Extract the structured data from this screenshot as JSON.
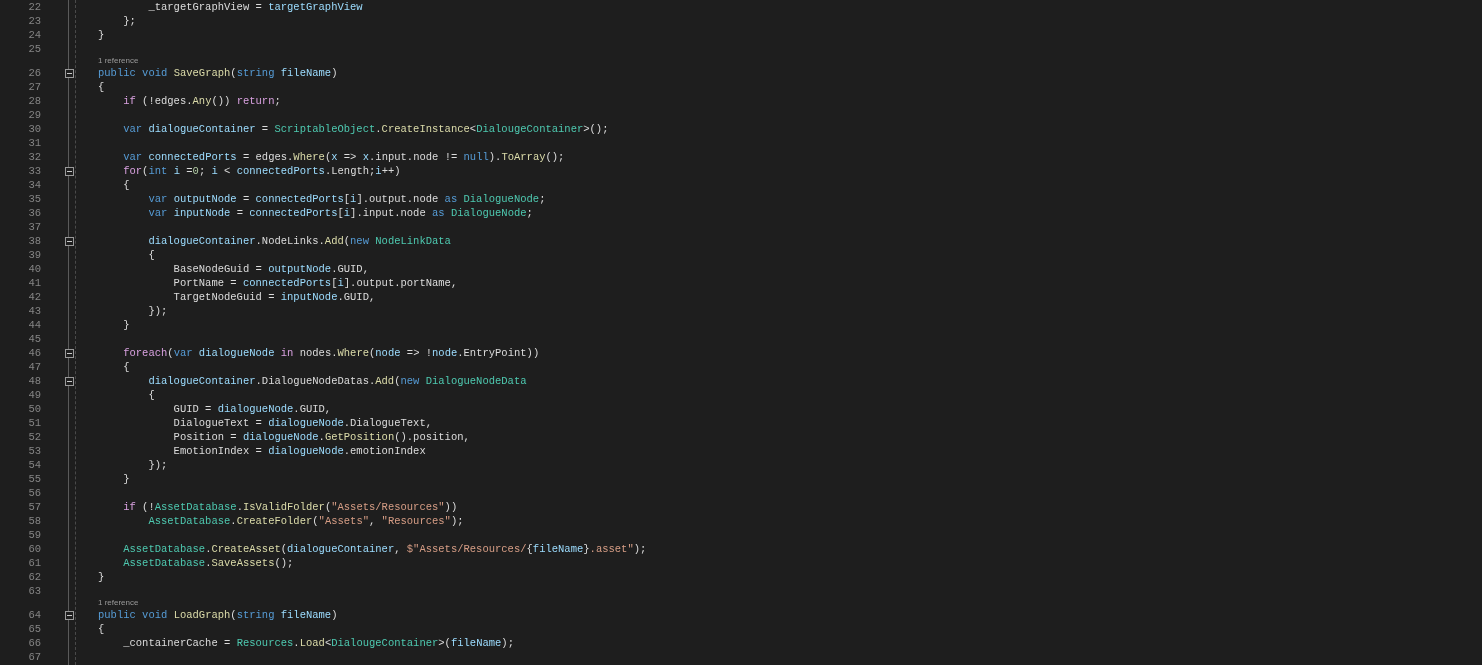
{
  "editor": {
    "lines": [
      {
        "kind": "code",
        "number": "22",
        "tokens": [
          {
            "kind": "plain",
            "text": "        _targetGraphView = "
          },
          {
            "kind": "var",
            "text": "targetGraphView"
          }
        ]
      },
      {
        "kind": "code",
        "number": "23",
        "tokens": [
          {
            "kind": "plain",
            "text": "    };"
          }
        ]
      },
      {
        "kind": "code",
        "number": "24",
        "tokens": [
          {
            "kind": "plain",
            "text": "}"
          }
        ]
      },
      {
        "kind": "code",
        "number": "25"
      },
      {
        "kind": "lens",
        "text": "1 reference"
      },
      {
        "kind": "code",
        "number": "26",
        "fold": {
          "expanded": true
        },
        "tokens": [
          {
            "kind": "kw",
            "text": "public void "
          },
          {
            "kind": "method",
            "text": "SaveGraph"
          },
          {
            "kind": "plain",
            "text": "("
          },
          {
            "kind": "kw",
            "text": "string "
          },
          {
            "kind": "var",
            "text": "fileName"
          },
          {
            "kind": "plain",
            "text": ")"
          }
        ]
      },
      {
        "kind": "code",
        "number": "27",
        "tokens": [
          {
            "kind": "plain",
            "text": "{"
          }
        ]
      },
      {
        "kind": "code",
        "number": "28",
        "tokens": [
          {
            "kind": "ctrl",
            "text": "    if"
          },
          {
            "kind": "plain",
            "text": " (!edges."
          },
          {
            "kind": "method",
            "text": "Any"
          },
          {
            "kind": "plain",
            "text": "()) "
          },
          {
            "kind": "ctrl",
            "text": "return"
          },
          {
            "kind": "plain",
            "text": ";"
          }
        ]
      },
      {
        "kind": "code",
        "number": "29"
      },
      {
        "kind": "code",
        "number": "30",
        "tokens": [
          {
            "kind": "kw",
            "text": "    var "
          },
          {
            "kind": "var",
            "text": "dialogueContainer"
          },
          {
            "kind": "plain",
            "text": " = "
          },
          {
            "kind": "type",
            "text": "ScriptableObject"
          },
          {
            "kind": "plain",
            "text": "."
          },
          {
            "kind": "method",
            "text": "CreateInstance"
          },
          {
            "kind": "plain",
            "text": "<"
          },
          {
            "kind": "type",
            "text": "DialougeContainer"
          },
          {
            "kind": "plain",
            "text": ">();"
          }
        ]
      },
      {
        "kind": "code",
        "number": "31"
      },
      {
        "kind": "code",
        "number": "32",
        "tokens": [
          {
            "kind": "kw",
            "text": "    var "
          },
          {
            "kind": "var",
            "text": "connectedPorts"
          },
          {
            "kind": "plain",
            "text": " = edges."
          },
          {
            "kind": "method",
            "text": "Where"
          },
          {
            "kind": "plain",
            "text": "("
          },
          {
            "kind": "var",
            "text": "x"
          },
          {
            "kind": "plain",
            "text": " => "
          },
          {
            "kind": "var",
            "text": "x"
          },
          {
            "kind": "plain",
            "text": ".input.node != "
          },
          {
            "kind": "kw",
            "text": "null"
          },
          {
            "kind": "plain",
            "text": ")."
          },
          {
            "kind": "method",
            "text": "ToArray"
          },
          {
            "kind": "plain",
            "text": "();"
          }
        ]
      },
      {
        "kind": "code",
        "number": "33",
        "fold": {
          "expanded": true
        },
        "tokens": [
          {
            "kind": "ctrl",
            "text": "    for"
          },
          {
            "kind": "plain",
            "text": "("
          },
          {
            "kind": "kw",
            "text": "int "
          },
          {
            "kind": "var",
            "text": "i"
          },
          {
            "kind": "plain",
            "text": " ="
          },
          {
            "kind": "num",
            "text": "0"
          },
          {
            "kind": "plain",
            "text": "; "
          },
          {
            "kind": "var",
            "text": "i"
          },
          {
            "kind": "plain",
            "text": " < "
          },
          {
            "kind": "var",
            "text": "connectedPorts"
          },
          {
            "kind": "plain",
            "text": ".Length;"
          },
          {
            "kind": "var",
            "text": "i"
          },
          {
            "kind": "plain",
            "text": "++)"
          }
        ]
      },
      {
        "kind": "code",
        "number": "34",
        "tokens": [
          {
            "kind": "plain",
            "text": "    {"
          }
        ]
      },
      {
        "kind": "code",
        "number": "35",
        "tokens": [
          {
            "kind": "kw",
            "text": "        var "
          },
          {
            "kind": "var",
            "text": "outputNode"
          },
          {
            "kind": "plain",
            "text": " = "
          },
          {
            "kind": "var",
            "text": "connectedPorts"
          },
          {
            "kind": "plain",
            "text": "["
          },
          {
            "kind": "var",
            "text": "i"
          },
          {
            "kind": "plain",
            "text": "].output.node "
          },
          {
            "kind": "kw",
            "text": "as "
          },
          {
            "kind": "type",
            "text": "DialogueNode"
          },
          {
            "kind": "plain",
            "text": ";"
          }
        ]
      },
      {
        "kind": "code",
        "number": "36",
        "tokens": [
          {
            "kind": "kw",
            "text": "        var "
          },
          {
            "kind": "var",
            "text": "inputNode"
          },
          {
            "kind": "plain",
            "text": " = "
          },
          {
            "kind": "var",
            "text": "connectedPorts"
          },
          {
            "kind": "plain",
            "text": "["
          },
          {
            "kind": "var",
            "text": "i"
          },
          {
            "kind": "plain",
            "text": "].input.node "
          },
          {
            "kind": "kw",
            "text": "as "
          },
          {
            "kind": "type",
            "text": "DialogueNode"
          },
          {
            "kind": "plain",
            "text": ";"
          }
        ]
      },
      {
        "kind": "code",
        "number": "37"
      },
      {
        "kind": "code",
        "number": "38",
        "fold": {
          "expanded": true
        },
        "tokens": [
          {
            "kind": "var",
            "text": "        dialogueContainer"
          },
          {
            "kind": "plain",
            "text": ".NodeLinks."
          },
          {
            "kind": "method",
            "text": "Add"
          },
          {
            "kind": "plain",
            "text": "("
          },
          {
            "kind": "kw",
            "text": "new "
          },
          {
            "kind": "type",
            "text": "NodeLinkData"
          }
        ]
      },
      {
        "kind": "code",
        "number": "39",
        "tokens": [
          {
            "kind": "plain",
            "text": "        {"
          }
        ]
      },
      {
        "kind": "code",
        "number": "40",
        "tokens": [
          {
            "kind": "plain",
            "text": "            BaseNodeGuid = "
          },
          {
            "kind": "var",
            "text": "outputNode"
          },
          {
            "kind": "plain",
            "text": ".GUID,"
          }
        ]
      },
      {
        "kind": "code",
        "number": "41",
        "tokens": [
          {
            "kind": "plain",
            "text": "            PortName = "
          },
          {
            "kind": "var",
            "text": "connectedPorts"
          },
          {
            "kind": "plain",
            "text": "["
          },
          {
            "kind": "var",
            "text": "i"
          },
          {
            "kind": "plain",
            "text": "].output.portName,"
          }
        ]
      },
      {
        "kind": "code",
        "number": "42",
        "tokens": [
          {
            "kind": "plain",
            "text": "            TargetNodeGuid = "
          },
          {
            "kind": "var",
            "text": "inputNode"
          },
          {
            "kind": "plain",
            "text": ".GUID,"
          }
        ]
      },
      {
        "kind": "code",
        "number": "43",
        "tokens": [
          {
            "kind": "plain",
            "text": "        });"
          }
        ]
      },
      {
        "kind": "code",
        "number": "44",
        "tokens": [
          {
            "kind": "plain",
            "text": "    }"
          }
        ]
      },
      {
        "kind": "code",
        "number": "45"
      },
      {
        "kind": "code",
        "number": "46",
        "fold": {
          "expanded": true
        },
        "tokens": [
          {
            "kind": "ctrl",
            "text": "    foreach"
          },
          {
            "kind": "plain",
            "text": "("
          },
          {
            "kind": "kw",
            "text": "var "
          },
          {
            "kind": "var",
            "text": "dialogueNode"
          },
          {
            "kind": "ctrl",
            "text": " in"
          },
          {
            "kind": "plain",
            "text": " nodes."
          },
          {
            "kind": "method",
            "text": "Where"
          },
          {
            "kind": "plain",
            "text": "("
          },
          {
            "kind": "var",
            "text": "node"
          },
          {
            "kind": "plain",
            "text": " => !"
          },
          {
            "kind": "var",
            "text": "node"
          },
          {
            "kind": "plain",
            "text": ".EntryPoint))"
          }
        ]
      },
      {
        "kind": "code",
        "number": "47",
        "tokens": [
          {
            "kind": "plain",
            "text": "    {"
          }
        ]
      },
      {
        "kind": "code",
        "number": "48",
        "fold": {
          "expanded": true
        },
        "tokens": [
          {
            "kind": "var",
            "text": "        dialogueContainer"
          },
          {
            "kind": "plain",
            "text": ".DialogueNodeDatas."
          },
          {
            "kind": "method",
            "text": "Add"
          },
          {
            "kind": "plain",
            "text": "("
          },
          {
            "kind": "kw",
            "text": "new "
          },
          {
            "kind": "type",
            "text": "DialogueNodeData"
          }
        ]
      },
      {
        "kind": "code",
        "number": "49",
        "tokens": [
          {
            "kind": "plain",
            "text": "        {"
          }
        ]
      },
      {
        "kind": "code",
        "number": "50",
        "tokens": [
          {
            "kind": "plain",
            "text": "            GUID = "
          },
          {
            "kind": "var",
            "text": "dialogueNode"
          },
          {
            "kind": "plain",
            "text": ".GUID,"
          }
        ]
      },
      {
        "kind": "code",
        "number": "51",
        "tokens": [
          {
            "kind": "plain",
            "text": "            DialogueText = "
          },
          {
            "kind": "var",
            "text": "dialogueNode"
          },
          {
            "kind": "plain",
            "text": ".DialogueText,"
          }
        ]
      },
      {
        "kind": "code",
        "number": "52",
        "tokens": [
          {
            "kind": "plain",
            "text": "            Position = "
          },
          {
            "kind": "var",
            "text": "dialogueNode"
          },
          {
            "kind": "plain",
            "text": "."
          },
          {
            "kind": "method",
            "text": "GetPosition"
          },
          {
            "kind": "plain",
            "text": "().position,"
          }
        ]
      },
      {
        "kind": "code",
        "number": "53",
        "tokens": [
          {
            "kind": "plain",
            "text": "            EmotionIndex = "
          },
          {
            "kind": "var",
            "text": "dialogueNode"
          },
          {
            "kind": "plain",
            "text": ".emotionIndex"
          }
        ]
      },
      {
        "kind": "code",
        "number": "54",
        "tokens": [
          {
            "kind": "plain",
            "text": "        });"
          }
        ]
      },
      {
        "kind": "code",
        "number": "55",
        "tokens": [
          {
            "kind": "plain",
            "text": "    }"
          }
        ]
      },
      {
        "kind": "code",
        "number": "56"
      },
      {
        "kind": "code",
        "number": "57",
        "tokens": [
          {
            "kind": "ctrl",
            "text": "    if"
          },
          {
            "kind": "plain",
            "text": " (!"
          },
          {
            "kind": "type",
            "text": "AssetDatabase"
          },
          {
            "kind": "plain",
            "text": "."
          },
          {
            "kind": "method",
            "text": "IsValidFolder"
          },
          {
            "kind": "plain",
            "text": "("
          },
          {
            "kind": "str",
            "text": "\"Assets/Resources\""
          },
          {
            "kind": "plain",
            "text": "))"
          }
        ]
      },
      {
        "kind": "code",
        "number": "58",
        "tokens": [
          {
            "kind": "type",
            "text": "        AssetDatabase"
          },
          {
            "kind": "plain",
            "text": "."
          },
          {
            "kind": "method",
            "text": "CreateFolder"
          },
          {
            "kind": "plain",
            "text": "("
          },
          {
            "kind": "str",
            "text": "\"Assets\""
          },
          {
            "kind": "plain",
            "text": ", "
          },
          {
            "kind": "str",
            "text": "\"Resources\""
          },
          {
            "kind": "plain",
            "text": ");"
          }
        ]
      },
      {
        "kind": "code",
        "number": "59"
      },
      {
        "kind": "code",
        "number": "60",
        "tokens": [
          {
            "kind": "type",
            "text": "    AssetDatabase"
          },
          {
            "kind": "plain",
            "text": "."
          },
          {
            "kind": "method",
            "text": "CreateAsset"
          },
          {
            "kind": "plain",
            "text": "("
          },
          {
            "kind": "var",
            "text": "dialogueContainer"
          },
          {
            "kind": "plain",
            "text": ", "
          },
          {
            "kind": "str",
            "text": "$\"Assets/Resources/"
          },
          {
            "kind": "plain",
            "text": "{"
          },
          {
            "kind": "var",
            "text": "fileName"
          },
          {
            "kind": "plain",
            "text": "}"
          },
          {
            "kind": "str",
            "text": ".asset\""
          },
          {
            "kind": "plain",
            "text": ");"
          }
        ]
      },
      {
        "kind": "code",
        "number": "61",
        "tokens": [
          {
            "kind": "type",
            "text": "    AssetDatabase"
          },
          {
            "kind": "plain",
            "text": "."
          },
          {
            "kind": "method",
            "text": "SaveAssets"
          },
          {
            "kind": "plain",
            "text": "();"
          }
        ]
      },
      {
        "kind": "code",
        "number": "62",
        "tokens": [
          {
            "kind": "plain",
            "text": "}"
          }
        ]
      },
      {
        "kind": "code",
        "number": "63"
      },
      {
        "kind": "lens",
        "text": "1 reference"
      },
      {
        "kind": "code",
        "number": "64",
        "fold": {
          "expanded": true
        },
        "tokens": [
          {
            "kind": "kw",
            "text": "public void "
          },
          {
            "kind": "method",
            "text": "LoadGraph"
          },
          {
            "kind": "plain",
            "text": "("
          },
          {
            "kind": "kw",
            "text": "string "
          },
          {
            "kind": "var",
            "text": "fileName"
          },
          {
            "kind": "plain",
            "text": ")"
          }
        ]
      },
      {
        "kind": "code",
        "number": "65",
        "tokens": [
          {
            "kind": "plain",
            "text": "{"
          }
        ]
      },
      {
        "kind": "code",
        "number": "66",
        "tokens": [
          {
            "kind": "plain",
            "text": "    _containerCache = "
          },
          {
            "kind": "type",
            "text": "Resources"
          },
          {
            "kind": "plain",
            "text": "."
          },
          {
            "kind": "method",
            "text": "Load"
          },
          {
            "kind": "plain",
            "text": "<"
          },
          {
            "kind": "type",
            "text": "DialougeContainer"
          },
          {
            "kind": "plain",
            "text": ">("
          },
          {
            "kind": "var",
            "text": "fileName"
          },
          {
            "kind": "plain",
            "text": ");"
          }
        ]
      },
      {
        "kind": "code",
        "number": "67"
      }
    ]
  }
}
